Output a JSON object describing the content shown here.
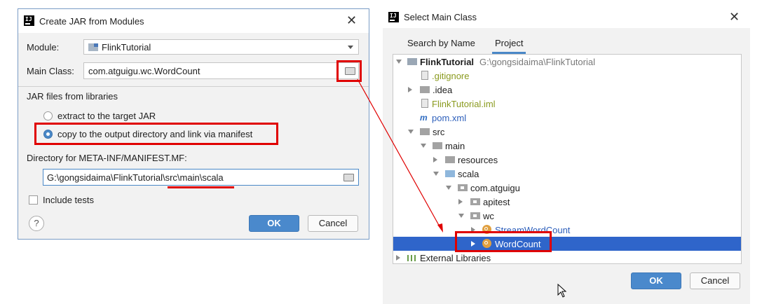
{
  "dialog1": {
    "title": "Create JAR from Modules",
    "module_label": "Module:",
    "module_value": "FlinkTutorial",
    "main_class_label": "Main Class:",
    "main_class_value": "com.atguigu.wc.WordCount",
    "libs_section": "JAR files from libraries",
    "option_extract": "extract to the target JAR",
    "option_copy": "copy to the output directory and link via manifest",
    "manifest_label": "Directory for META-INF/MANIFEST.MF:",
    "manifest_value": "G:\\gongsidaima\\FlinkTutorial\\src\\main\\scala",
    "include_tests": "Include tests",
    "help": "?",
    "ok": "OK",
    "cancel": "Cancel"
  },
  "dialog2": {
    "title": "Select Main Class",
    "tabs": [
      "Search by Name",
      "Project"
    ],
    "tree": {
      "root_name": "FlinkTutorial",
      "root_path": "G:\\gongsidaima\\FlinkTutorial",
      "gitignore": ".gitignore",
      "idea": ".idea",
      "iml": "FlinkTutorial.iml",
      "pom": "pom.xml",
      "src": "src",
      "main": "main",
      "resources": "resources",
      "scala": "scala",
      "pkg": "com.atguigu",
      "apitest": "apitest",
      "wc": "wc",
      "stream_wc": "StreamWordCount",
      "wordcount": "WordCount",
      "external": "External Libraries"
    },
    "ok": "OK",
    "cancel": "Cancel"
  },
  "colors": {
    "accent": "#4a88c7",
    "selection": "#2f65ca",
    "highlight_red": "#e00000",
    "git_ignored": "#8a9a1e",
    "stream_text": "#2d5fbb"
  }
}
